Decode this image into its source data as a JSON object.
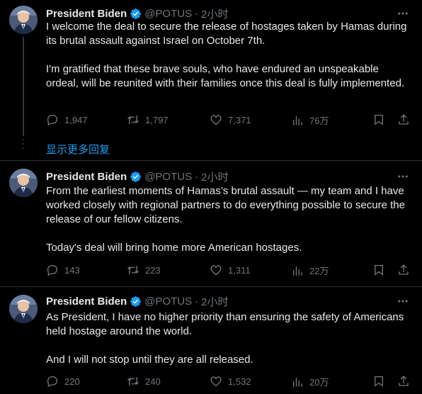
{
  "tweets": [
    {
      "author": "President Biden",
      "handle": "@POTUS",
      "time": "2小时",
      "paragraphs": [
        "I welcome the deal to secure the release of hostages taken by Hamas during its brutal assault against Israel on October 7th.",
        "I'm gratified that these brave souls, who have endured an unspeakable ordeal, will be reunited with their families once this deal is fully implemented."
      ],
      "replies": "1,947",
      "reposts": "1,797",
      "likes": "7,371",
      "views": "76万"
    },
    {
      "author": "President Biden",
      "handle": "@POTUS",
      "time": "2小时",
      "paragraphs": [
        "From the earliest moments of Hamas’s brutal assault — my team and I have worked closely with regional partners to do everything possible to secure the release of our fellow citizens.",
        "Today's deal will bring home more American hostages."
      ],
      "replies": "143",
      "reposts": "223",
      "likes": "1,311",
      "views": "22万"
    },
    {
      "author": "President Biden",
      "handle": "@POTUS",
      "time": "2小时",
      "paragraphs": [
        "As President, I have no higher priority than ensuring the safety of Americans held hostage around the world.",
        "And I will not stop until they are all released."
      ],
      "replies": "220",
      "reposts": "240",
      "likes": "1,532",
      "views": "20万"
    }
  ],
  "show_more_replies": "显示更多回复",
  "colors": {
    "background": "#000000",
    "text": "#e7e9ea",
    "muted": "#71767b",
    "link": "#1d9bf0",
    "verified": "#1d9bf0"
  },
  "icons": [
    "more-icon",
    "verified-badge-icon",
    "reply-icon",
    "repost-icon",
    "like-icon",
    "views-icon",
    "bookmark-icon",
    "share-icon"
  ]
}
